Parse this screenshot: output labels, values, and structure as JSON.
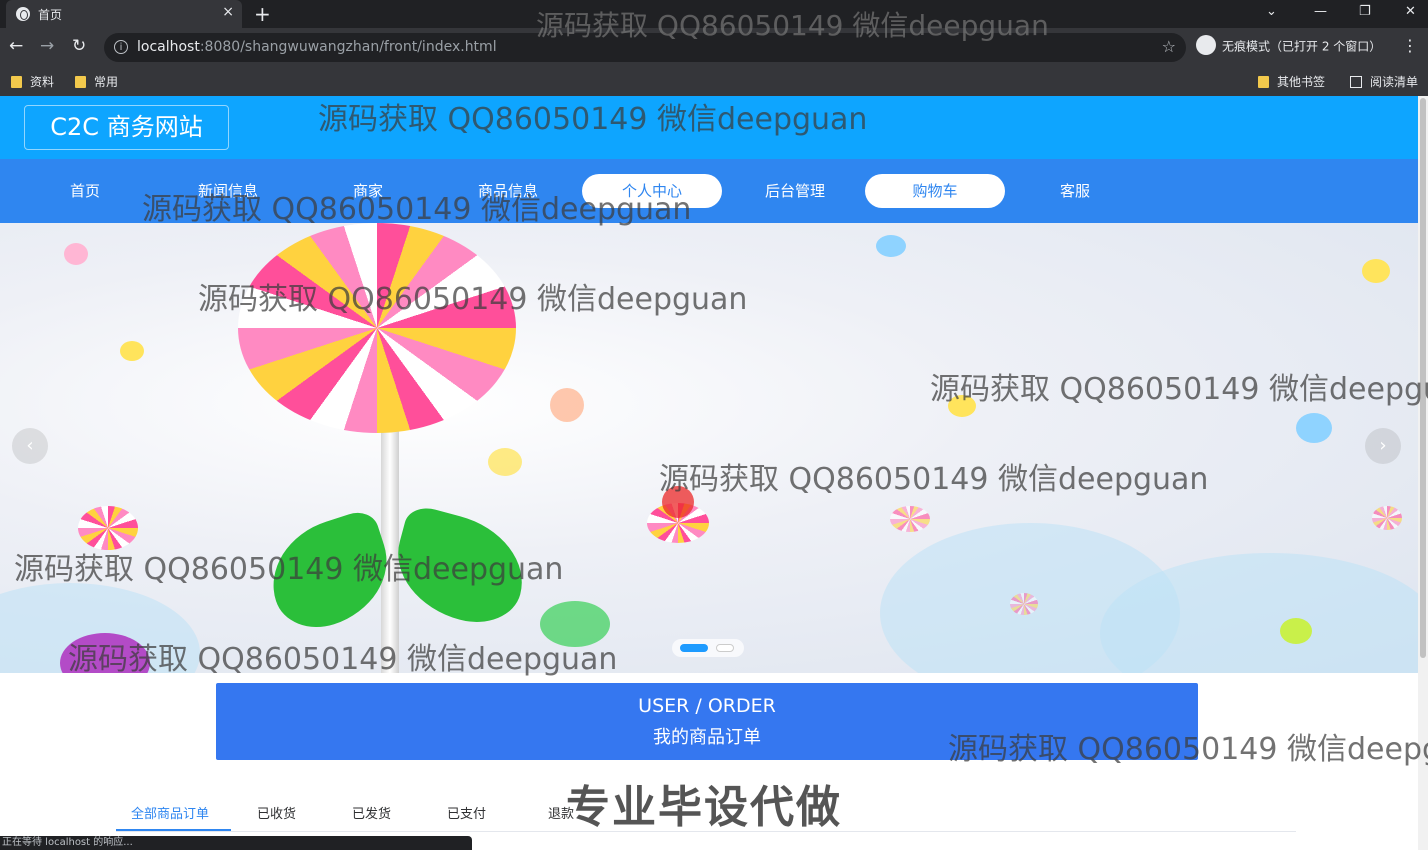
{
  "browser": {
    "tab_title": "首页",
    "tab_close": "×",
    "new_tab": "+",
    "url_host": "localhost",
    "url_rest": ":8080/shangwuwangzhan/front/index.html",
    "incognito_label": "无痕模式（已打开 2 个窗口）",
    "bookmarks": [
      "资料",
      "常用"
    ],
    "bookmarks_right": [
      "其他书签",
      "阅读清单"
    ],
    "status_text": "正在等待 localhost 的响应..."
  },
  "site": {
    "logo": "C2C 商务网站",
    "nav": [
      "首页",
      "新闻信息",
      "商家",
      "商品信息",
      "个人中心",
      "后台管理",
      "购物车",
      "客服"
    ],
    "nav_active": [
      "个人中心",
      "购物车"
    ]
  },
  "order_banner": {
    "en": "USER / ORDER",
    "cn": "我的商品订单"
  },
  "order_tabs": [
    "全部商品订单",
    "已收货",
    "已发货",
    "已支付",
    "退款"
  ],
  "order_tabs_active": "全部商品订单",
  "promo": "专业毕设代做",
  "watermark": "源码获取 QQ86050149 微信deepguan",
  "colors": {
    "header": "#0ea5ff",
    "nav": "#2f86f0",
    "order_banner": "#3577f0",
    "promo": "#555555"
  }
}
